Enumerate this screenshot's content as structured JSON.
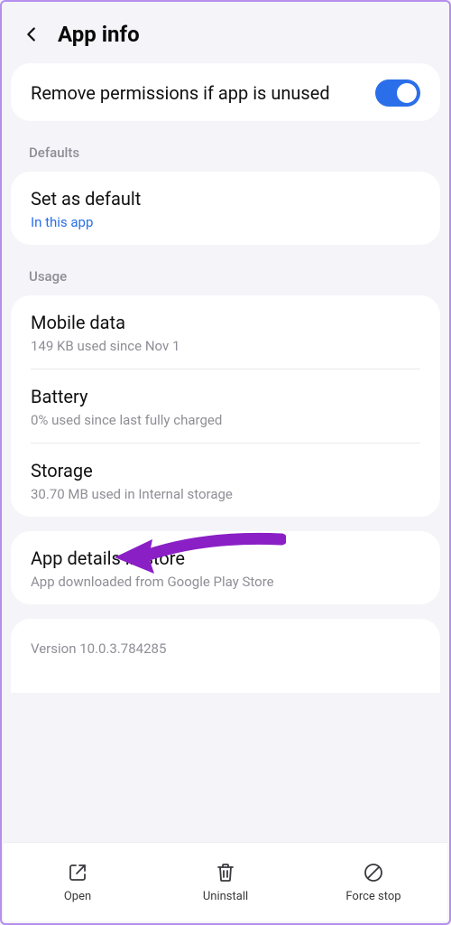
{
  "header": {
    "title": "App info"
  },
  "toggleRow": {
    "label": "Remove permissions if app is unused",
    "enabled": true
  },
  "sections": {
    "defaults": {
      "label": "Defaults",
      "setAsDefault": {
        "title": "Set as default",
        "subtitle": "In this app"
      }
    },
    "usage": {
      "label": "Usage",
      "mobileData": {
        "title": "Mobile data",
        "subtitle": "149 KB used since Nov 1"
      },
      "battery": {
        "title": "Battery",
        "subtitle": "0% used since last fully charged"
      },
      "storage": {
        "title": "Storage",
        "subtitle": "30.70 MB used in Internal storage"
      }
    }
  },
  "appDetails": {
    "title": "App details in store",
    "subtitle": "App downloaded from Google Play Store"
  },
  "version": {
    "text": "Version 10.0.3.784285"
  },
  "bottomBar": {
    "open": "Open",
    "uninstall": "Uninstall",
    "forceStop": "Force stop"
  },
  "colors": {
    "accent": "#2a6fe9",
    "annotation": "#8424c2"
  }
}
